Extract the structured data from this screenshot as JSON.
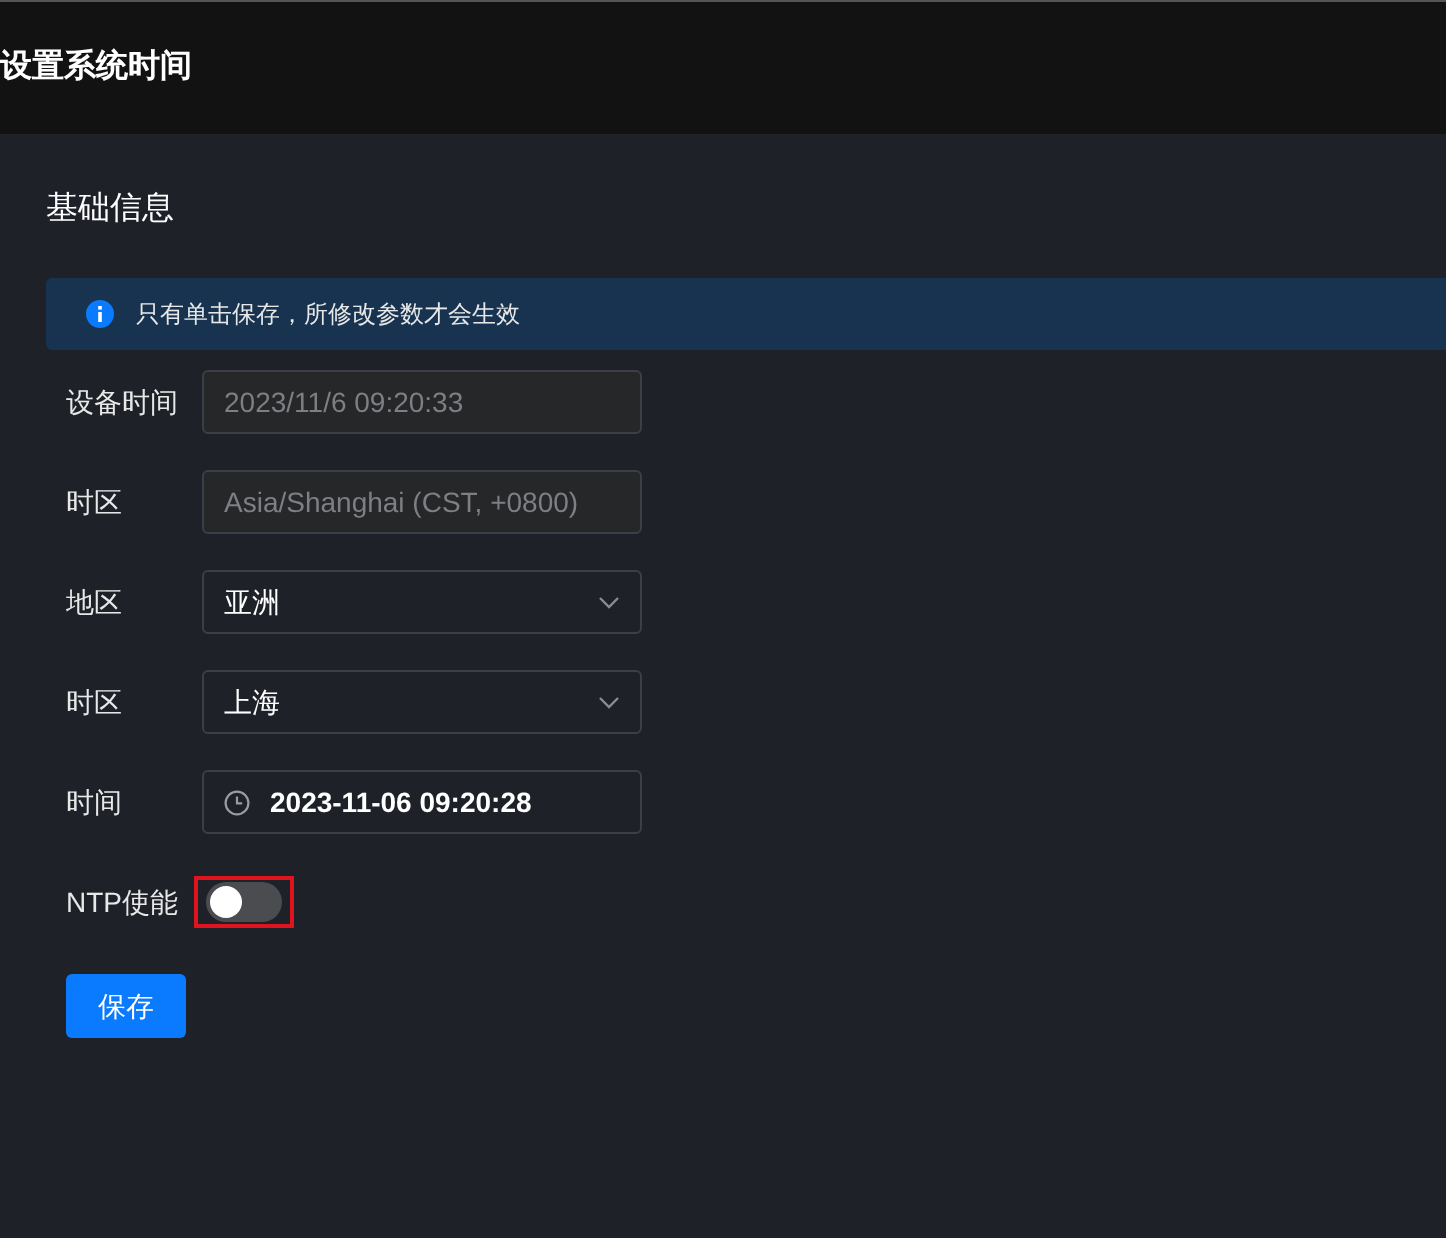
{
  "header": {
    "title": "设置系统时间"
  },
  "section": {
    "title": "基础信息"
  },
  "alert": {
    "text": "只有单击保存，所修改参数才会生效"
  },
  "fields": [
    {
      "label": "设备时间",
      "kind": "readonly",
      "value": "2023/11/6 09:20:33"
    },
    {
      "label": "时区",
      "kind": "readonly",
      "value": "Asia/Shanghai (CST, +0800)"
    },
    {
      "label": "地区",
      "kind": "select",
      "value": "亚洲"
    },
    {
      "label": "时区",
      "kind": "select",
      "value": "上海"
    },
    {
      "label": "时间",
      "kind": "time",
      "value": "2023-11-06 09:20:28"
    }
  ],
  "ntp": {
    "label": "NTP使能",
    "on": false,
    "highlighted": true
  },
  "save_button": "保存"
}
